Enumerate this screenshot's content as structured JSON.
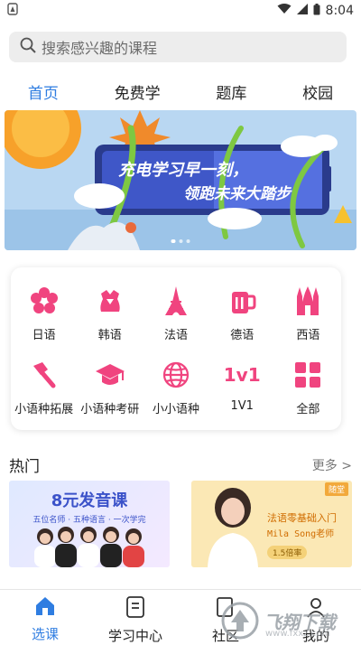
{
  "status": {
    "time": "8:04"
  },
  "search": {
    "placeholder": "搜索感兴趣的课程"
  },
  "tabs": [
    {
      "label": "首页",
      "active": true
    },
    {
      "label": "免费学"
    },
    {
      "label": "题库"
    },
    {
      "label": "校园"
    }
  ],
  "banner": {
    "line1": "充电学习早一刻，",
    "line2": "领跑未来大踏步",
    "dots": 3,
    "active_dot": 0
  },
  "categories": [
    {
      "label": "日语",
      "icon": "sakura-icon"
    },
    {
      "label": "韩语",
      "icon": "hanbok-icon"
    },
    {
      "label": "法语",
      "icon": "eiffel-tower-icon"
    },
    {
      "label": "德语",
      "icon": "beer-mug-icon"
    },
    {
      "label": "西语",
      "icon": "cathedral-icon"
    },
    {
      "label": "小语种拓展",
      "icon": "torch-icon"
    },
    {
      "label": "小语种考研",
      "icon": "graduation-cap-icon"
    },
    {
      "label": "小小语种",
      "icon": "globe-icon"
    },
    {
      "label": "1V1",
      "icon": "1v1-icon",
      "icon_text": "1v1"
    },
    {
      "label": "全部",
      "icon": "grid-icon"
    }
  ],
  "hot": {
    "title": "热门",
    "more": "更多 >",
    "courses": [
      {
        "title": "8元发音课",
        "subtitle": "五位名师 · 五种语言 · 一次学完"
      },
      {
        "tag": "随堂",
        "title": "法语零基础入门",
        "teacher": "Mila Song老师",
        "badge": "1.5倍率"
      }
    ]
  },
  "bottom_nav": [
    {
      "label": "选课",
      "icon": "home-icon",
      "active": true
    },
    {
      "label": "学习中心",
      "icon": "book-icon"
    },
    {
      "label": "社区",
      "icon": "community-icon"
    },
    {
      "label": "我的",
      "icon": "user-icon"
    }
  ],
  "watermark": {
    "text": "飞翔下载",
    "url": "www.fxxz.com"
  },
  "colors": {
    "accent": "#2f7de1",
    "pink": "#f0447f"
  }
}
